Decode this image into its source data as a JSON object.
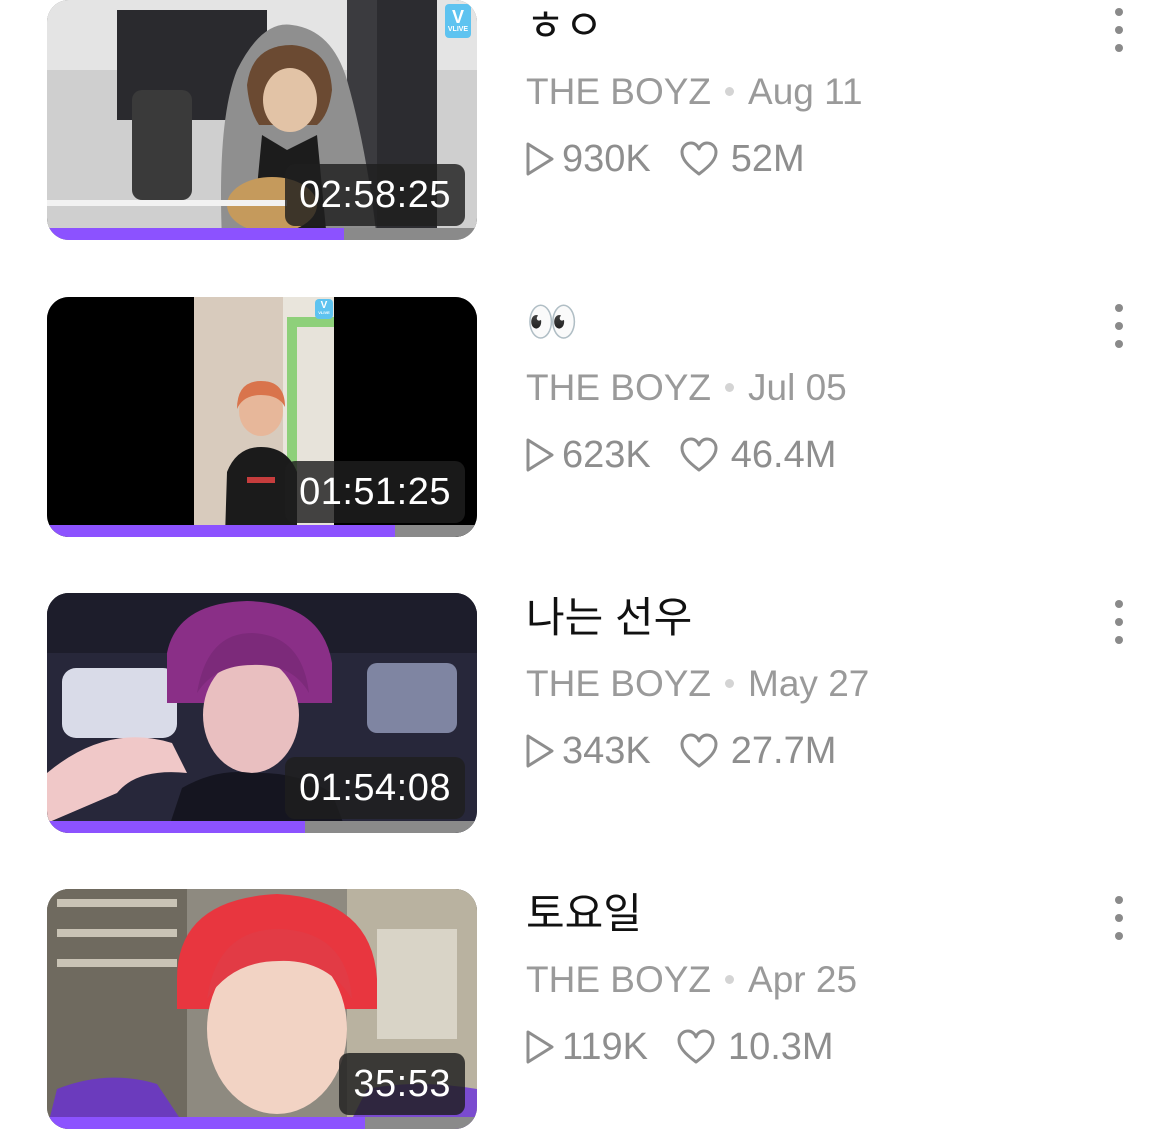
{
  "videos": [
    {
      "title": "ㅎㅇ",
      "channel": "THE BOYZ",
      "date": "Aug 11",
      "views": "930K",
      "likes": "52M",
      "duration": "02:58:25",
      "progress": 0.69
    },
    {
      "title": "👀",
      "channel": "THE BOYZ",
      "date": "Jul 05",
      "views": "623K",
      "likes": "46.4M",
      "duration": "01:51:25",
      "progress": 0.81
    },
    {
      "title": "나는 선우",
      "channel": "THE BOYZ",
      "date": "May 27",
      "views": "343K",
      "likes": "27.7M",
      "duration": "01:54:08",
      "progress": 0.6
    },
    {
      "title": "토요일",
      "channel": "THE BOYZ",
      "date": "Apr 25",
      "views": "119K",
      "likes": "10.3M",
      "duration": "35:53",
      "progress": 0.74
    }
  ],
  "badge": {
    "letter": "V",
    "text": "VLIVE"
  },
  "colors": {
    "progress_fill": "#8c52ff",
    "progress_track": "#8a8a8a",
    "title": "#111111",
    "meta": "#9a9a9a"
  },
  "icons": {
    "views": "play-outline-icon",
    "likes": "heart-outline-icon",
    "more": "more-vertical-icon"
  }
}
